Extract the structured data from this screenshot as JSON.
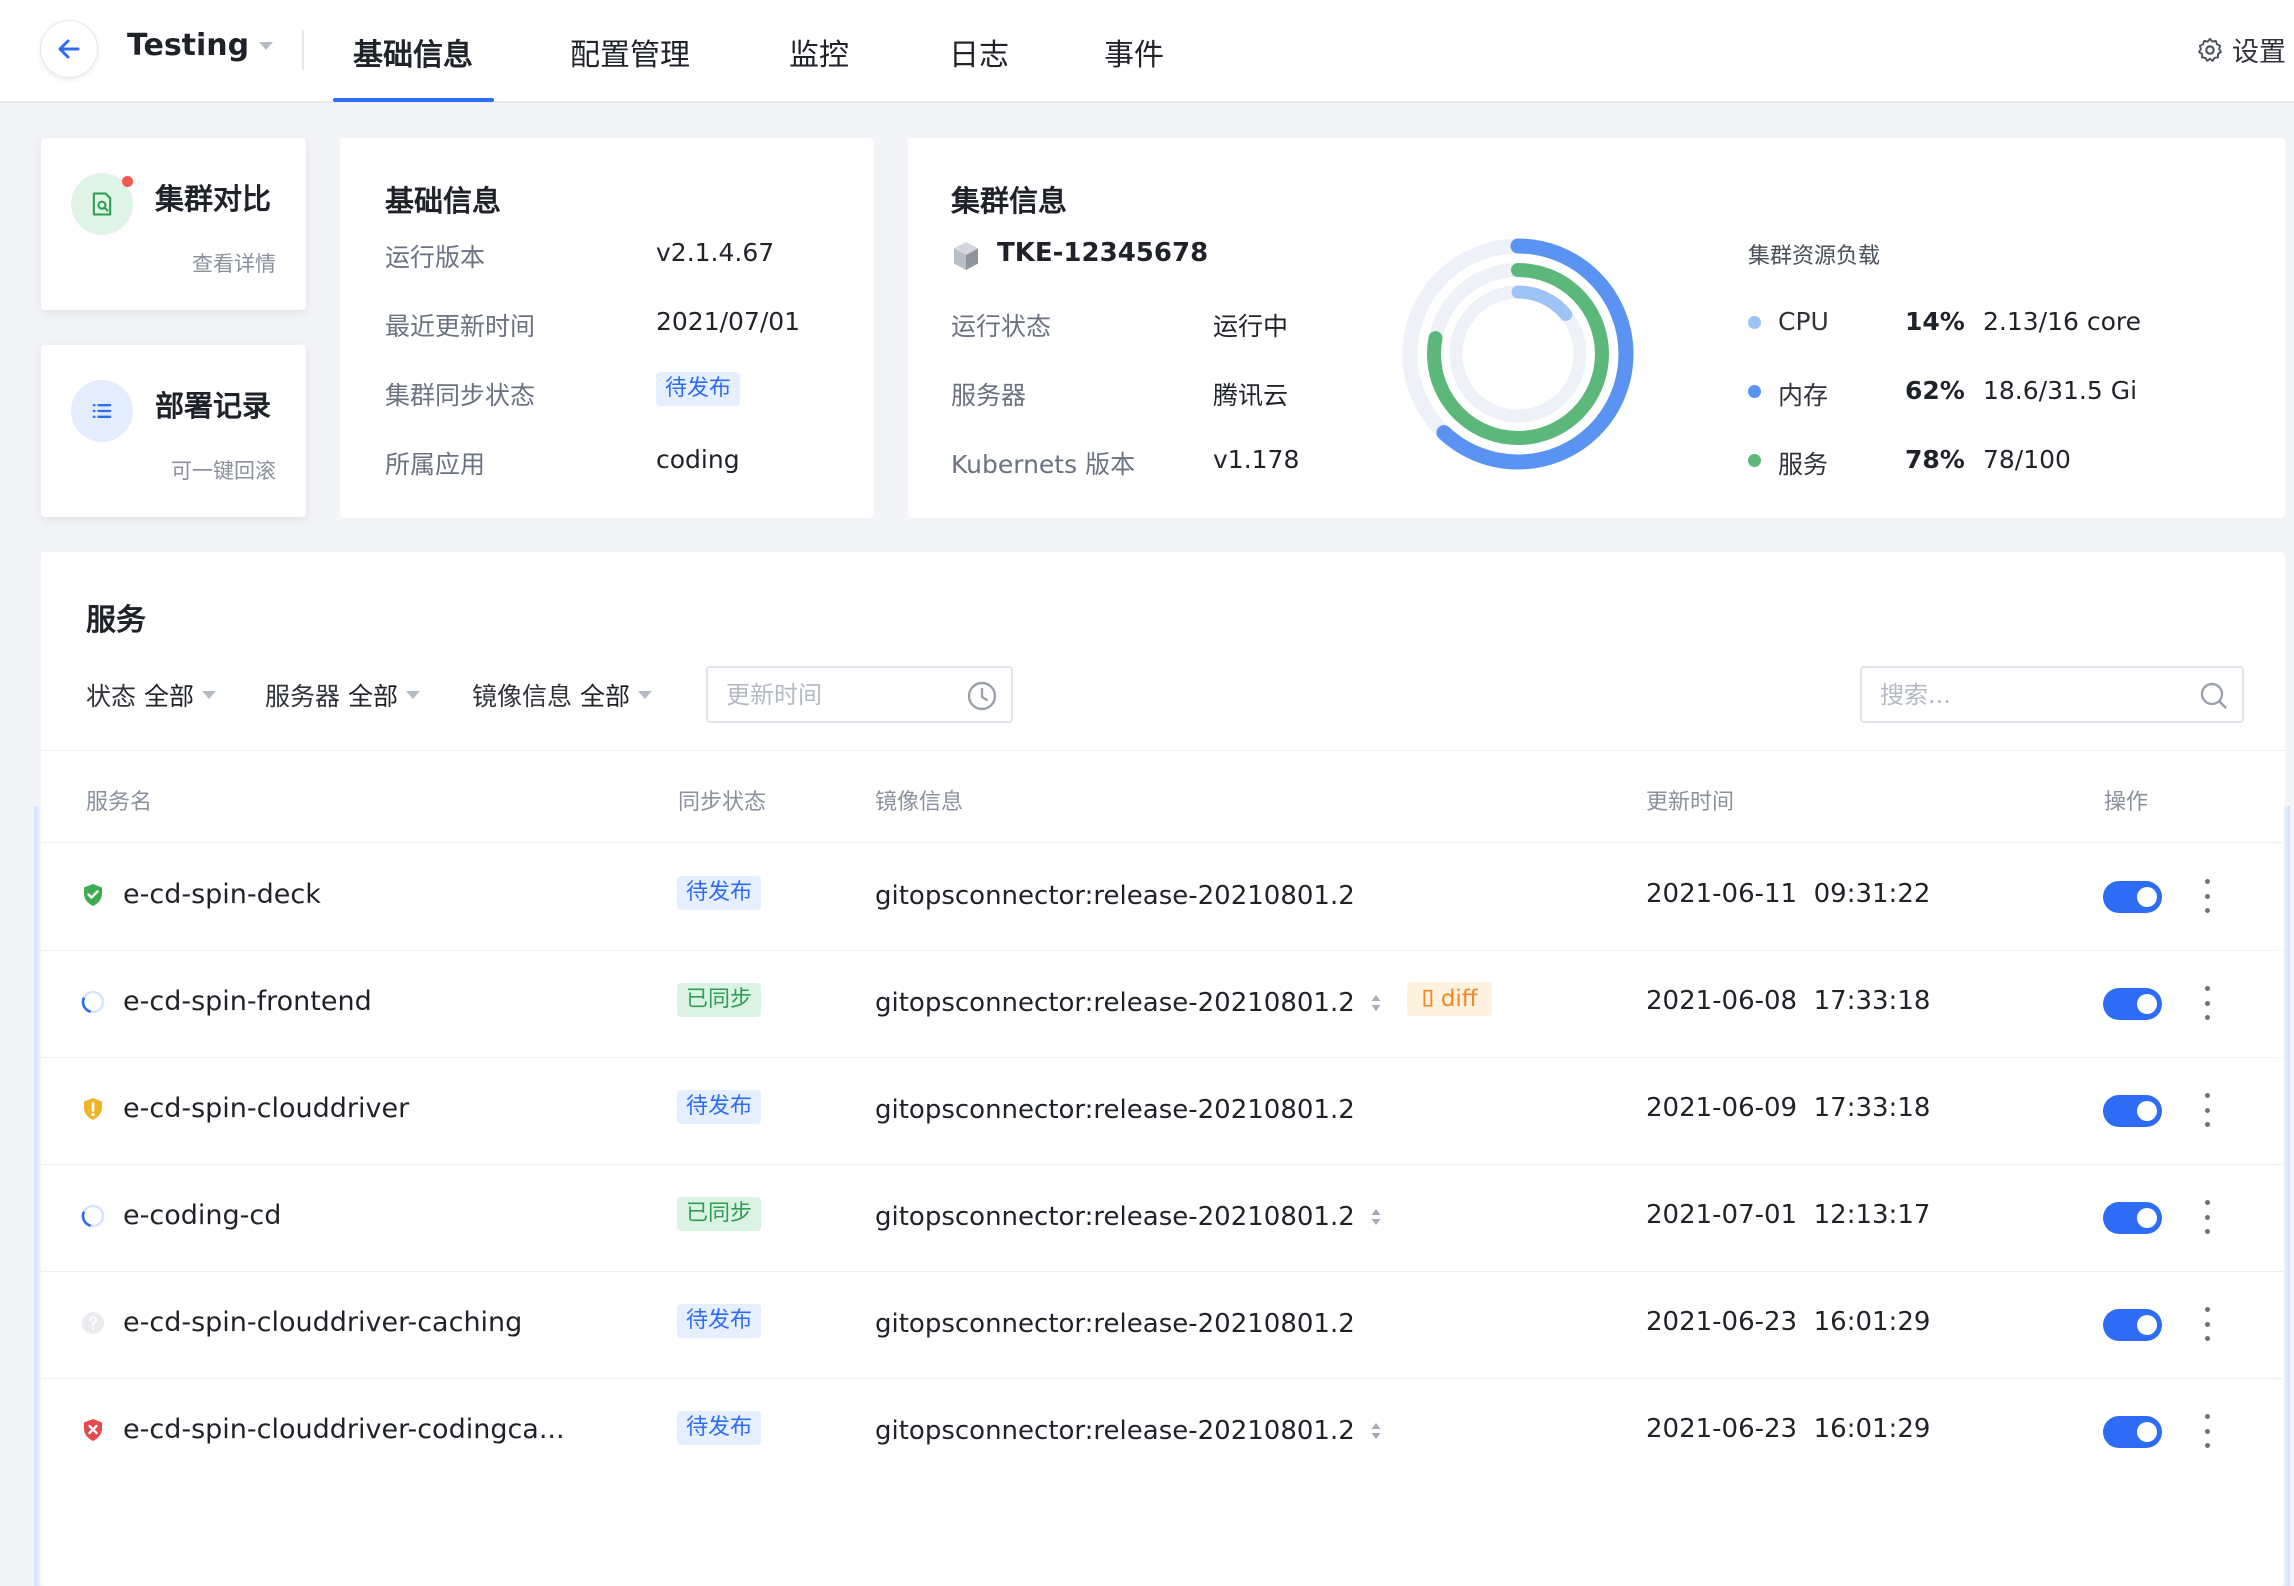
{
  "header": {
    "env_name": "Testing",
    "tabs": [
      {
        "label": "基础信息",
        "active": true
      },
      {
        "label": "配置管理",
        "active": false
      },
      {
        "label": "监控",
        "active": false
      },
      {
        "label": "日志",
        "active": false
      },
      {
        "label": "事件",
        "active": false
      }
    ],
    "settings_label": "设置"
  },
  "mini_cards": [
    {
      "title": "集群对比",
      "link": "查看详情",
      "icon": "file-search-icon",
      "has_badge": true
    },
    {
      "title": "部署记录",
      "link": "可一键回滚",
      "icon": "list-icon"
    }
  ],
  "basic_info": {
    "title": "基础信息",
    "rows": [
      {
        "label": "运行版本",
        "value": "v2.1.4.67"
      },
      {
        "label": "最近更新时间",
        "value": "2021/07/01"
      },
      {
        "label": "集群同步状态",
        "value": "待发布"
      },
      {
        "label": "所属应用",
        "value": "coding"
      }
    ]
  },
  "cluster_info": {
    "title": "集群信息",
    "cluster_name": "TKE-12345678",
    "rows": [
      {
        "label": "运行状态",
        "value": "运行中"
      },
      {
        "label": "服务器",
        "value": "腾讯云"
      },
      {
        "label": "Kubernets 版本",
        "value": "v1.178"
      }
    ],
    "resource_title": "集群资源负载",
    "resources": [
      {
        "name": "CPU",
        "percent": "14%",
        "value": "2.13/16 core",
        "color": "#9ec3f7",
        "fraction": 0.14
      },
      {
        "name": "内存",
        "percent": "62%",
        "value": "18.6/31.5 Gi",
        "color": "#5b93f3",
        "fraction": 0.62
      },
      {
        "name": "服务",
        "percent": "78%",
        "value": "78/100",
        "color": "#5cb87a",
        "fraction": 0.78
      }
    ]
  },
  "services": {
    "title": "服务",
    "filters": [
      {
        "label": "状态",
        "value": "全部"
      },
      {
        "label": "服务器",
        "value": "全部"
      },
      {
        "label": "镜像信息",
        "value": "全部"
      }
    ],
    "time_placeholder": "更新时间",
    "search_placeholder": "搜索...",
    "columns": [
      "服务名",
      "同步状态",
      "镜像信息",
      "更新时间",
      "操作"
    ],
    "rows": [
      {
        "name": "e-cd-spin-deck",
        "status_icon": "shield-check-icon",
        "sync": "待发布",
        "sync_type": "pending",
        "image": "gitopsconnector:release-20210801.2",
        "sortable": false,
        "diff": "",
        "time": "2021-06-11  09:31:22",
        "enabled": true
      },
      {
        "name": "e-cd-spin-frontend",
        "status_icon": "loading-icon",
        "sync": "已同步",
        "sync_type": "synced",
        "image": "gitopsconnector:release-20210801.2",
        "sortable": true,
        "diff": "diff",
        "time": "2021-06-08  17:33:18",
        "enabled": true
      },
      {
        "name": "e-cd-spin-clouddriver",
        "status_icon": "shield-warning-icon",
        "sync": "待发布",
        "sync_type": "pending",
        "image": "gitopsconnector:release-20210801.2",
        "sortable": false,
        "diff": "",
        "time": "2021-06-09  17:33:18",
        "enabled": true
      },
      {
        "name": "e-coding-cd",
        "status_icon": "loading-icon",
        "sync": "已同步",
        "sync_type": "synced",
        "image": "gitopsconnector:release-20210801.2",
        "sortable": true,
        "diff": "",
        "time": "2021-07-01  12:13:17",
        "enabled": true
      },
      {
        "name": "e-cd-spin-clouddriver-caching",
        "status_icon": "question-icon",
        "sync": "待发布",
        "sync_type": "pending",
        "image": "gitopsconnector:release-20210801.2",
        "sortable": false,
        "diff": "",
        "time": "2021-06-23  16:01:29",
        "enabled": true
      },
      {
        "name": "e-cd-spin-clouddriver-codingca...",
        "status_icon": "shield-error-icon",
        "sync": "待发布",
        "sync_type": "pending",
        "image": "gitopsconnector:release-20210801.2",
        "sortable": true,
        "diff": "",
        "time": "2021-06-23  16:01:29",
        "enabled": true
      }
    ]
  }
}
